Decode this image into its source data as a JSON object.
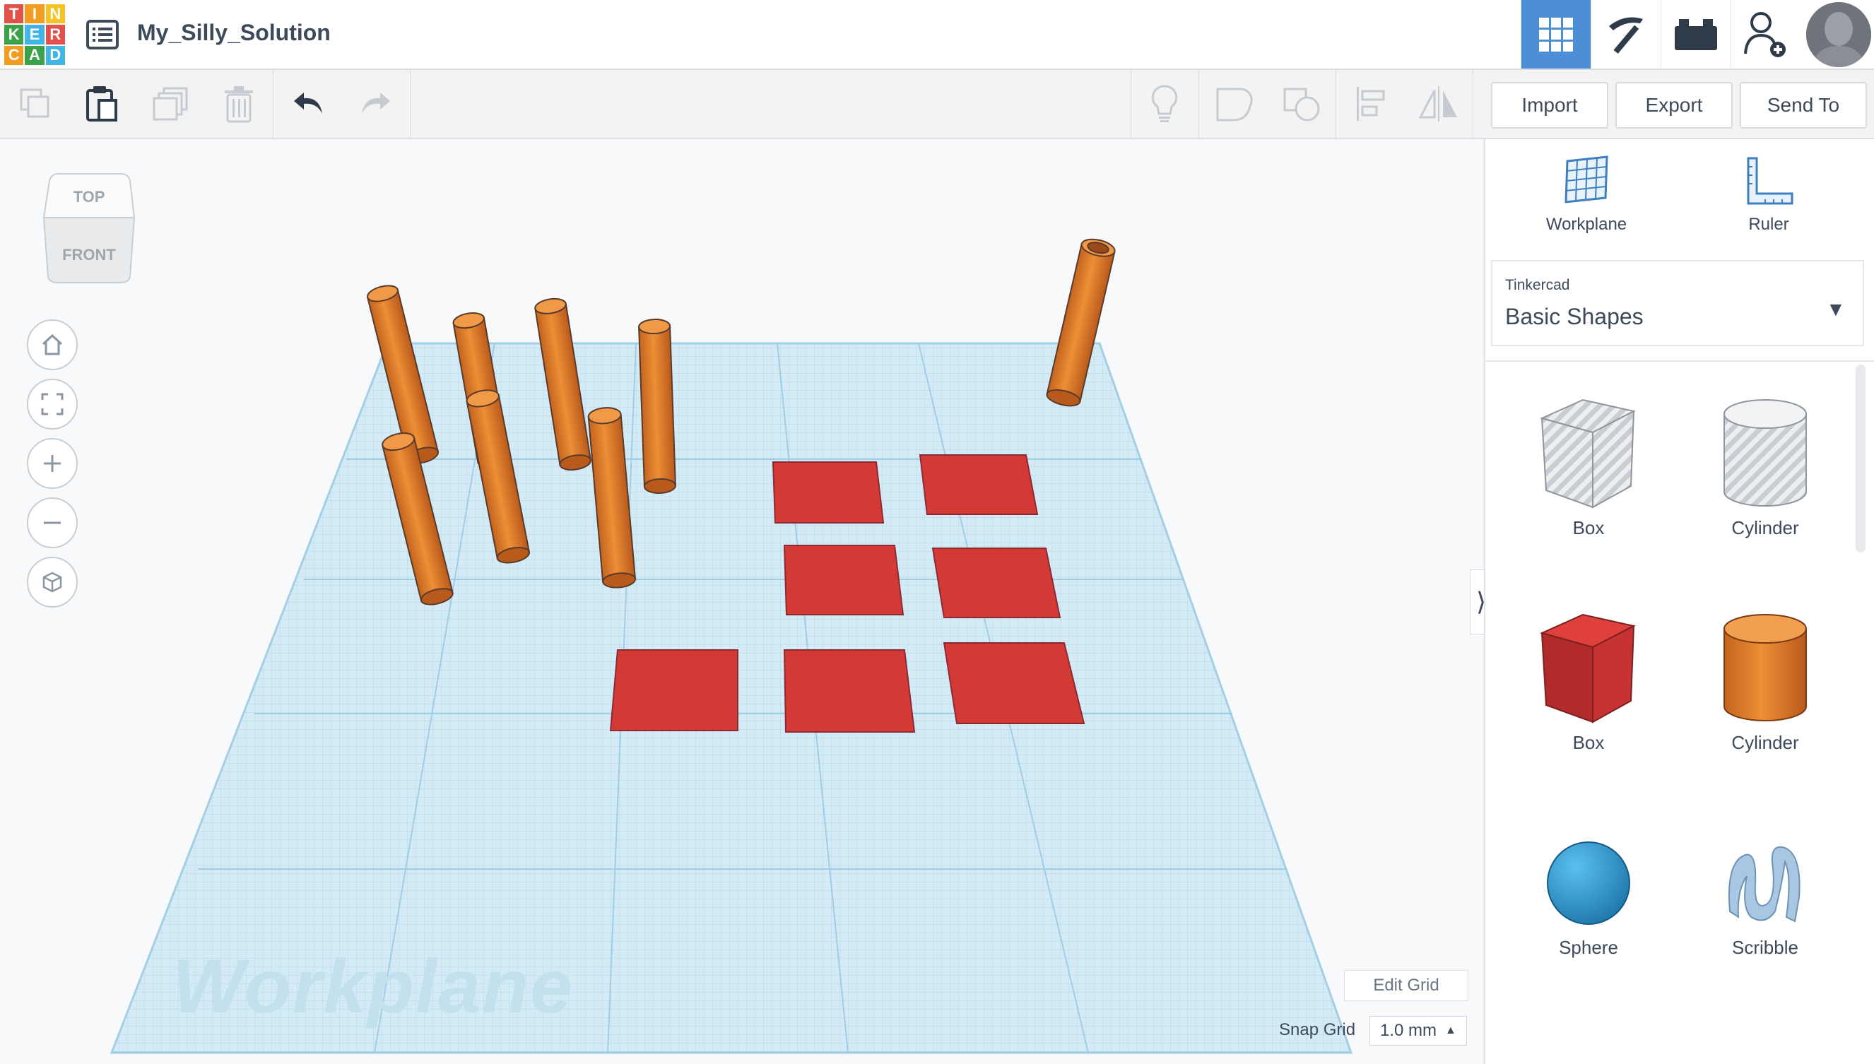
{
  "app": {
    "logo_letters": [
      "T",
      "I",
      "N",
      "K",
      "E",
      "R",
      "C",
      "A",
      "D"
    ],
    "logo_colors": [
      "#e2524a",
      "#f39c22",
      "#f6c324",
      "#3aa34a",
      "#41b6e6",
      "#e2524a",
      "#f39c22",
      "#3aa34a",
      "#41b6e6"
    ],
    "design_title": "My_Silly_Solution"
  },
  "topbar": {
    "buttons": [
      "grid-view",
      "build-pickaxe",
      "bricks",
      "add-user"
    ],
    "active_color": "#4c8fd6"
  },
  "toolbar": {
    "left_tools": [
      "copy",
      "paste",
      "duplicate",
      "delete",
      "undo",
      "redo"
    ],
    "right_tools": [
      "light-bulb",
      "group",
      "ungroup",
      "align",
      "mirror"
    ],
    "import_label": "Import",
    "export_label": "Export",
    "send_to_label": "Send To"
  },
  "viewcube": {
    "top": "TOP",
    "front": "FRONT"
  },
  "canvas": {
    "workplane_watermark": "Workplane",
    "edit_grid_label": "Edit Grid",
    "snap_grid_label": "Snap Grid",
    "snap_grid_value": "1.0 mm",
    "orange": "#e2832f",
    "red": "#d33a36"
  },
  "panel": {
    "workplane_label": "Workplane",
    "ruler_label": "Ruler",
    "library_source": "Tinkercad",
    "library_name": "Basic Shapes",
    "shapes": [
      {
        "label": "Box"
      },
      {
        "label": "Cylinder"
      },
      {
        "label": "Box"
      },
      {
        "label": "Cylinder"
      },
      {
        "label": "Sphere"
      },
      {
        "label": "Scribble"
      }
    ]
  }
}
